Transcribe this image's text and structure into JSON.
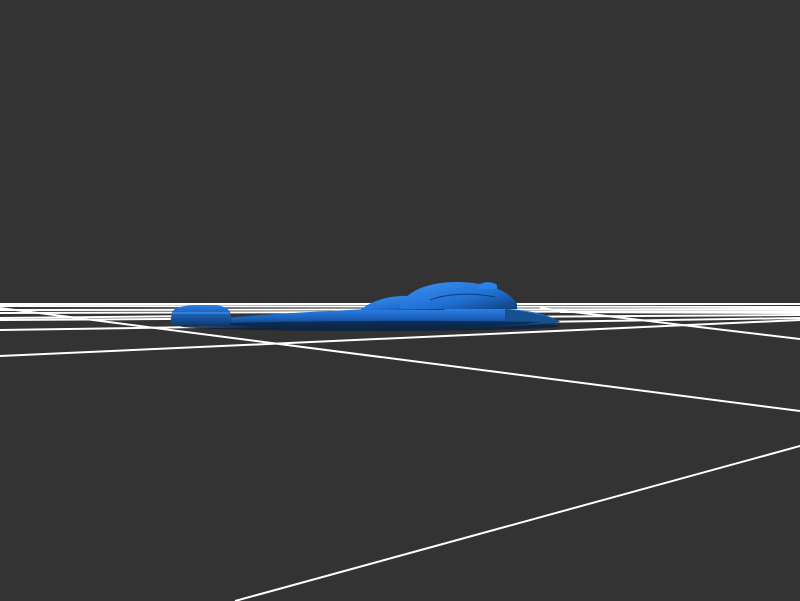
{
  "scene": {
    "background_color": "#333333",
    "grid_color": "#ffffff",
    "model_color": "#1f6fd1",
    "model_shadow_color": "#0d2f57",
    "model_highlight_color": "#3f8ff0"
  }
}
